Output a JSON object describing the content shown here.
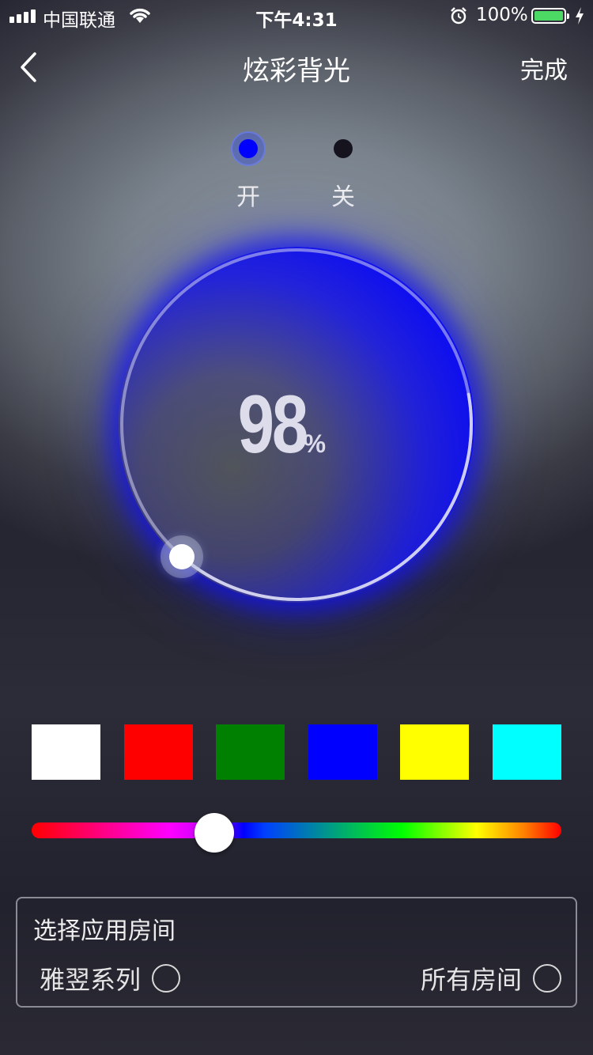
{
  "status_bar": {
    "carrier": "中国联通",
    "time": "下午4:31",
    "battery_percent": "100%",
    "battery_level": 1.0
  },
  "nav": {
    "title": "炫彩背光",
    "done_label": "完成"
  },
  "power": {
    "on_label": "开",
    "off_label": "关",
    "selected": "on"
  },
  "brightness": {
    "value": "98",
    "unit": "%",
    "fraction": 0.98
  },
  "colors": {
    "swatches": [
      "#ffffff",
      "#ff0000",
      "#008000",
      "#0000ff",
      "#ffff00",
      "#00ffff"
    ],
    "hue_position": 0.34,
    "active_color": "#0000ff"
  },
  "rooms": {
    "title": "选择应用房间",
    "options": [
      {
        "label": "雅翌系列",
        "selected": false
      },
      {
        "label": "所有房间",
        "selected": false
      }
    ]
  }
}
